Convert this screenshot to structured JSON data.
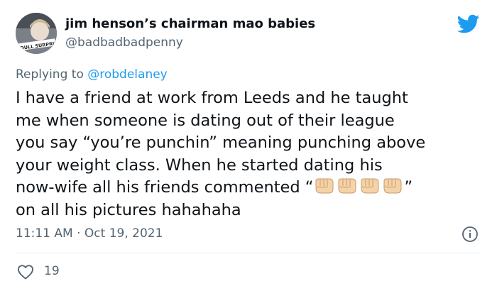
{
  "tweet": {
    "display_name": "jim henson’s chairman mao babies",
    "handle": "@badbadbadpenny",
    "avatar_caption": "DULL SURPRISE",
    "replying_prefix": "Replying to",
    "replying_to": "@robdelaney",
    "text_lines": [
      "I have a friend at work from Leeds and he taught",
      "me when someone is dating out of their league",
      "you say “you’re punchin” meaning punching above",
      "your weight class. When he started dating his"
    ],
    "line5_text": "now-wife all his friends commented “",
    "line5_close": "”",
    "line6_text": "on all his pictures hahahaha",
    "emoji_count": 4,
    "emoji_icon": "oncoming-fist-emoji",
    "timestamp": "11:11 AM · Oct 19, 2021",
    "likes": "19"
  },
  "icons": {
    "brand": "twitter-bird-icon",
    "info": "info-icon",
    "like": "heart-icon"
  },
  "colors": {
    "text": "#0f1419",
    "secondary": "#536471",
    "accent": "#1d9bf0",
    "divider": "#e6ecf0",
    "fist": "#f5d3a8"
  }
}
